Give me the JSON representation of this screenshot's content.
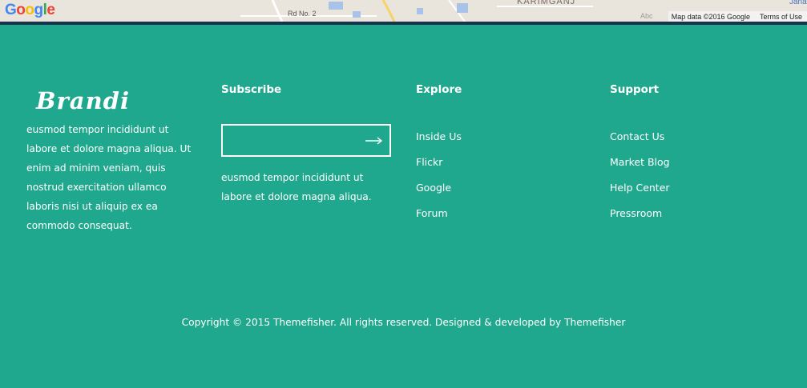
{
  "map": {
    "logo": [
      "G",
      "o",
      "o",
      "g",
      "l",
      "e"
    ],
    "road_label": "Rd No. 2",
    "area_label": "KARIMGANJ",
    "abc_label": "Abc",
    "corner_label": "Jana",
    "attribution": "Map data ©2016 Google",
    "terms": "Terms of Use"
  },
  "footer": {
    "brand": "Brandi",
    "brand_text": "eusmod tempor incididunt ut labore et dolore magna aliqua. Ut enim ad minim veniam, quis nostrud exercitation ullamco laboris nisi ut aliquip ex ea commodo consequat.",
    "subscribe": {
      "title": "Subscribe",
      "input_value": "",
      "text": "eusmod tempor incididunt ut labore et dolore magna aliqua."
    },
    "explore": {
      "title": "Explore",
      "links": [
        "Inside Us",
        "Flickr",
        "Google",
        "Forum"
      ]
    },
    "support": {
      "title": "Support",
      "links": [
        "Contact Us",
        "Market Blog",
        "Help Center",
        "Pressroom"
      ]
    },
    "copyright": "Copyright © 2015 Themefisher. All rights reserved. Designed & developed by Themefisher"
  },
  "colors": {
    "footer_bg": "#1fa88d",
    "divider": "#17324a",
    "text": "#ffffff"
  }
}
